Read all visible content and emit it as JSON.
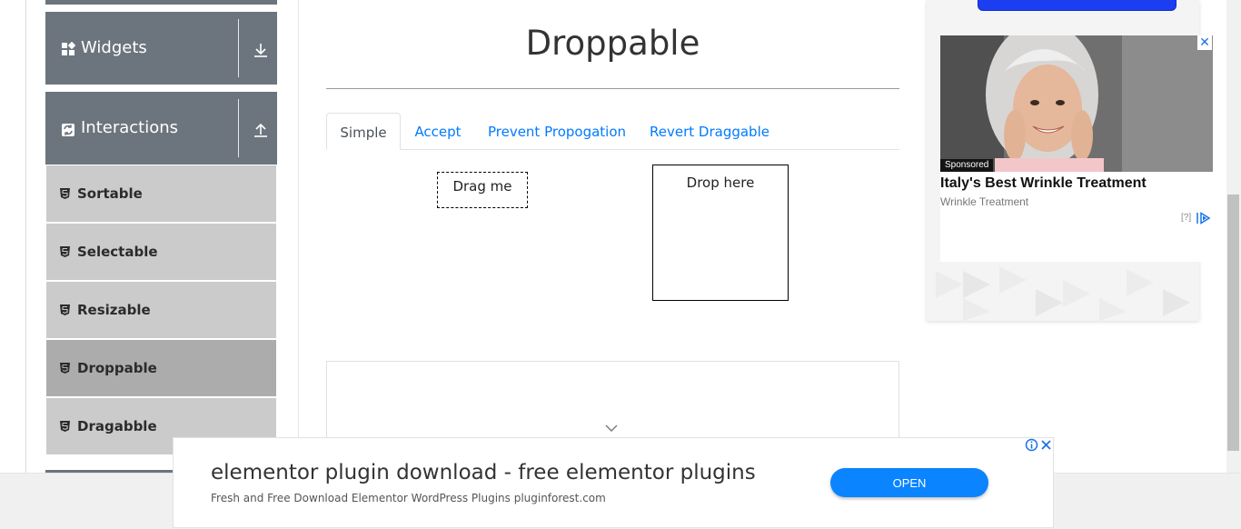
{
  "sidebar": {
    "groups": [
      {
        "title": "Widgets",
        "icon": "widgets-icon",
        "arrow": "download-arrow-icon"
      },
      {
        "title": "Interactions",
        "icon": "interactions-icon",
        "arrow": "upload-arrow-icon"
      }
    ],
    "items": [
      {
        "label": "Sortable",
        "active": false
      },
      {
        "label": "Selectable",
        "active": false
      },
      {
        "label": "Resizable",
        "active": false
      },
      {
        "label": "Droppable",
        "active": true
      },
      {
        "label": "Dragabble",
        "active": false
      }
    ]
  },
  "main": {
    "title": "Droppable",
    "tabs": [
      {
        "label": "Simple",
        "active": true
      },
      {
        "label": "Accept",
        "active": false
      },
      {
        "label": "Prevent Propogation",
        "active": false
      },
      {
        "label": "Revert Draggable",
        "active": false
      }
    ],
    "drag_label": "Drag me",
    "drop_label": "Drop here"
  },
  "right_ad": {
    "sponsored": "Sponsored",
    "headline": "Italy's Best Wrinkle Treatment",
    "subtitle": "Wrinkle Treatment",
    "help": "[?]",
    "close": "✕"
  },
  "bottom_ad": {
    "title": "elementor plugin download - free elementor plugins",
    "description": "Fresh and Free Download Elementor WordPress Plugins pluginforest.com",
    "button": "OPEN"
  },
  "colors": {
    "sidebar_header": "#6c757d",
    "menu_item": "#cbcbcb",
    "menu_item_active": "#acacac",
    "link": "#007bff",
    "ad_button": "#0a84ff"
  }
}
